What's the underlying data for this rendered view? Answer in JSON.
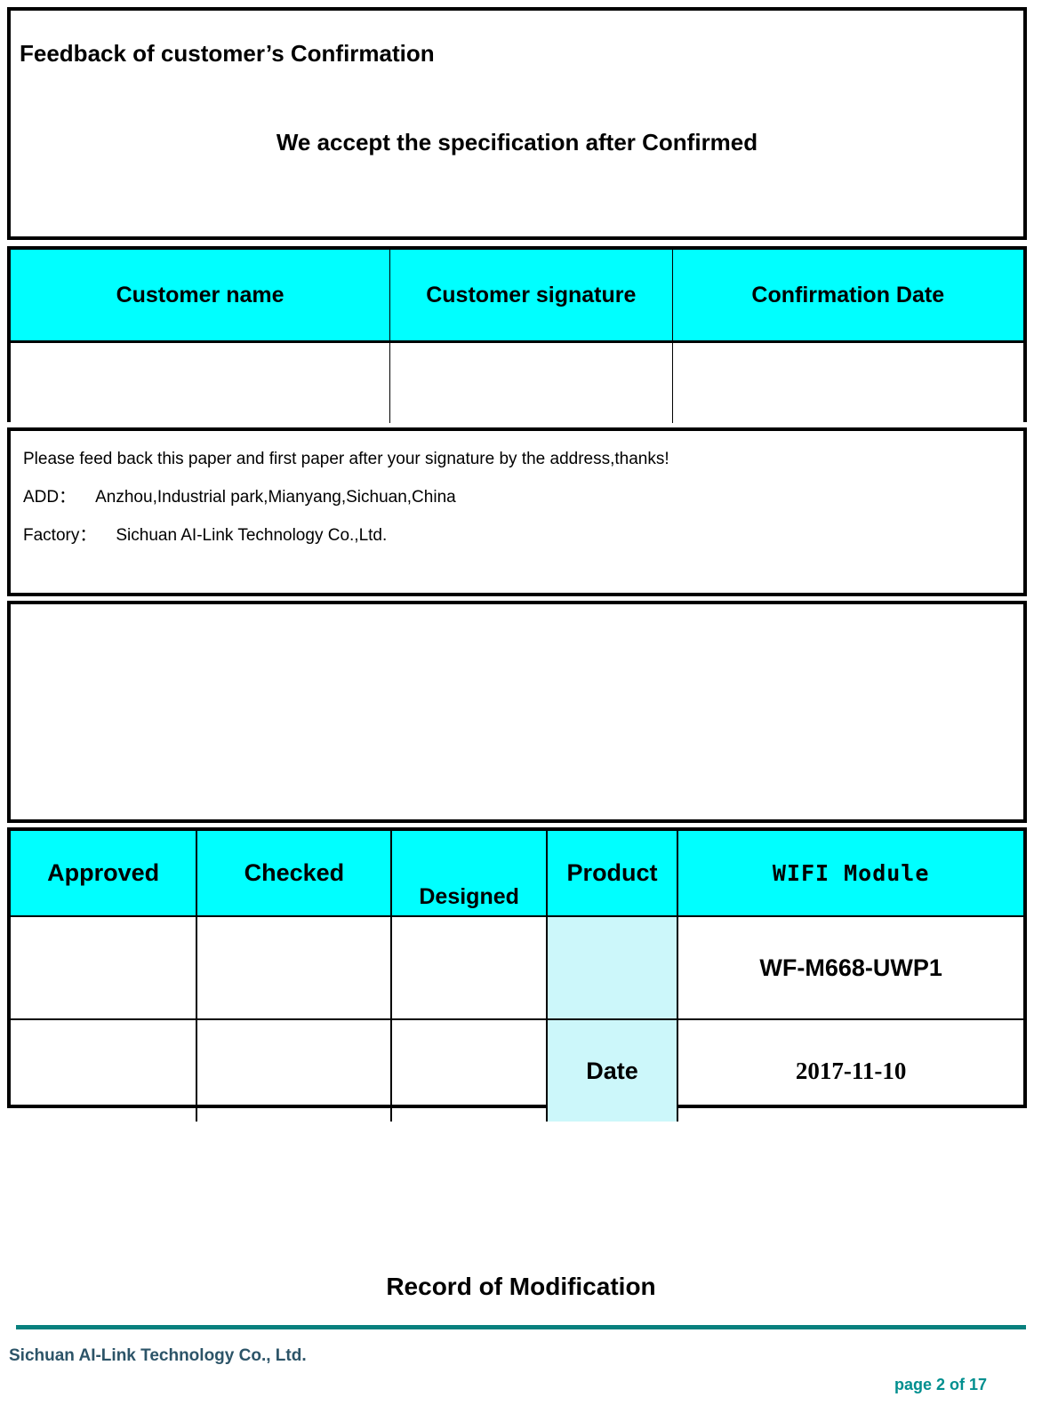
{
  "document": {
    "intro": {
      "title": "Feedback of customer’s Confirmation",
      "subtitle": "We accept the specification after Confirmed"
    },
    "signature_table": {
      "headers": [
        "Customer name",
        "Customer signature",
        "Confirmation Date"
      ],
      "rows": [
        [
          "",
          "",
          ""
        ]
      ],
      "header_bg": "#00FFFF"
    },
    "note": {
      "line1": "Please feed back this paper and first paper after your signature by the address,thanks!",
      "line2_label": "ADD：",
      "line2_value": "Anzhou,Industrial park,Mianyang,Sichuan,China",
      "line3_label": "Factory：",
      "line3_value": "Sichuan AI-Link Technology Co.,Ltd."
    },
    "approval_table": {
      "headers": {
        "approved": "Approved",
        "checked": "Checked",
        "designed": "Designed",
        "product": "Product",
        "wifi_module": "WIFI Module"
      },
      "row_product": {
        "approved": "",
        "checked": "",
        "designed": "",
        "label": "",
        "value": "WF-M668-UWP1"
      },
      "row_date": {
        "approved": "",
        "checked": "",
        "designed": "",
        "label": "Date",
        "value": "2017-11-10"
      },
      "header_bg": "#00FFFF",
      "tint_bg": "#CCF7FA"
    },
    "record_heading": "Record of Modification",
    "footer": {
      "company": "Sichuan AI-Link Technology Co., Ltd.",
      "page_label": "page",
      "page_current": "2",
      "page_of": "of",
      "page_total": "17",
      "page_text": "page 2 of 17",
      "rule_color": "#08807E",
      "company_color": "#2C5468",
      "page_color": "#018F8F"
    }
  }
}
